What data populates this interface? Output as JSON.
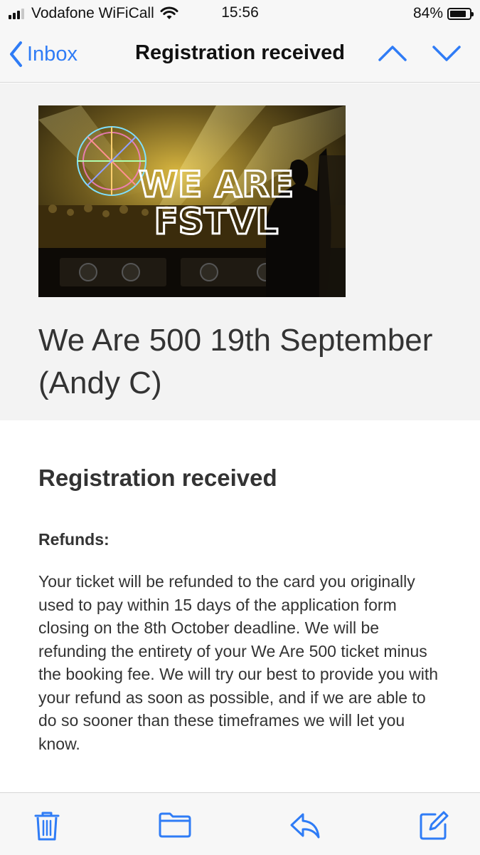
{
  "status_bar": {
    "carrier": "Vodafone WiFiCall",
    "time": "15:56",
    "battery_percent_label": "84%",
    "battery_level": 0.84
  },
  "nav": {
    "back_label": "Inbox",
    "title": "Registration received"
  },
  "email": {
    "banner_logo_text": [
      "WE ARE",
      "FSTVL"
    ],
    "event_title": "We Are 500 19th September (Andy C)",
    "heading": "Registration received",
    "refunds_label": "Refunds:",
    "refund_text": "Your ticket will be refunded to the card you originally used to pay within 15 days of the application form closing on the 8th October deadline. We will be refunding the entirety of your We Are 500 ticket minus the booking fee. We will try our best to provide you with your refund as soon as possible, and if we are able to do so sooner than these timeframes we will let you know."
  },
  "toolbar": {
    "icons": [
      "trash-icon",
      "folder-icon",
      "reply-icon",
      "compose-icon"
    ]
  },
  "colors": {
    "accent": "#2f7cf6",
    "bar_background": "#f7f7f7",
    "header_background": "#f3f3f3",
    "text": "#333333"
  }
}
